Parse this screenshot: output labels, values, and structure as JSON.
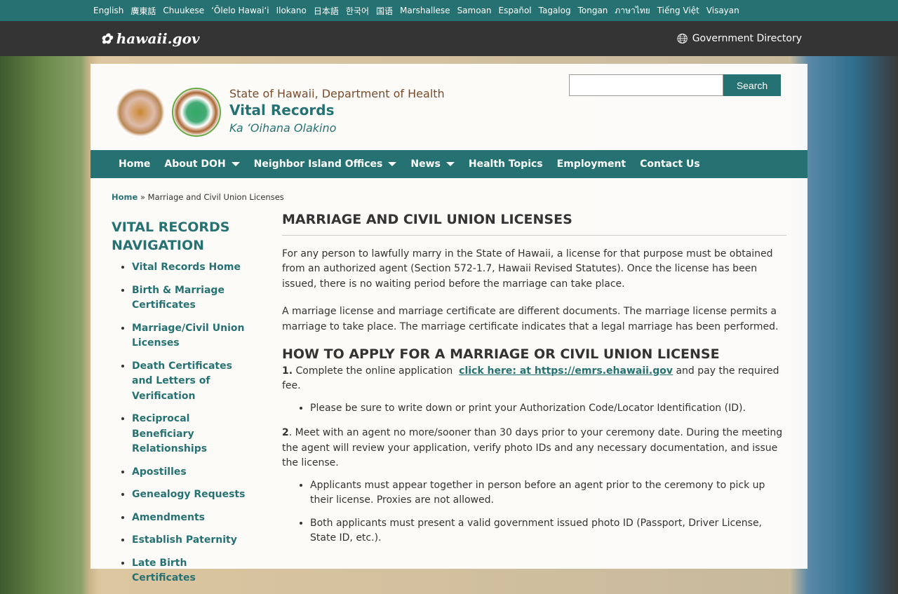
{
  "languages": [
    "English",
    "廣東話",
    "Chuukese",
    "ʻŌlelo Hawaiʻi",
    "Ilokano",
    "日本語",
    "한국어",
    "国语",
    "Marshallese",
    "Samoan",
    "Español",
    "Tagalog",
    "Tongan",
    "ภาษาไทย",
    "Tiếng Việt",
    "Visayan"
  ],
  "topbar": {
    "logo": "hawaii.gov",
    "directory": "Government Directory"
  },
  "header": {
    "line1": "State of Hawaii, Department of Health",
    "line2": "Vital Records",
    "line3": "Ka ʻOihana Olakino",
    "search_button": "Search",
    "search_value": ""
  },
  "nav": [
    {
      "label": "Home",
      "dropdown": false
    },
    {
      "label": "About DOH",
      "dropdown": true
    },
    {
      "label": "Neighbor Island Offices",
      "dropdown": true
    },
    {
      "label": "News",
      "dropdown": true
    },
    {
      "label": "Health Topics",
      "dropdown": false
    },
    {
      "label": "Employment",
      "dropdown": false
    },
    {
      "label": "Contact Us",
      "dropdown": false
    }
  ],
  "breadcrumb": {
    "home": "Home",
    "sep": " » ",
    "current": "Marriage and Civil Union Licenses"
  },
  "sidebar": {
    "title": "VITAL RECORDS NAVIGATION",
    "items": [
      "Vital Records Home",
      "Birth & Marriage Certificates",
      "Marriage/Civil Union Licenses",
      "Death Certificates and Letters of Verification",
      "Reciprocal Beneficiary Relationships",
      "Apostilles",
      "Genealogy Requests",
      "Amendments",
      "Establish Paternity",
      "Late Birth Certificates"
    ]
  },
  "main": {
    "title": "MARRIAGE AND CIVIL UNION LICENSES",
    "p1": "For any person to lawfully marry in the State of Hawaii, a license for that purpose must be obtained from an authorized agent (Section 572-1.7, Hawaii Revised Statutes). Once the license has been issued, there is no waiting period before the marriage can take place.",
    "p2": "A marriage license and marriage certificate are different documents. The marriage license permits a marriage to take place. The marriage certificate indicates that a legal marriage has been performed.",
    "h2": "HOW TO APPLY FOR A MARRIAGE OR CIVIL UNION LICENSE",
    "step1_num": "1.",
    "step1_text": " Complete the online application  ",
    "step1_link": "click here: at https://emrs.ehawaii.gov",
    "step1_after": " and pay the required fee.",
    "bullet1": "Please be sure to write down or print your Authorization Code/Locator Identification (ID).",
    "step2_num": "2",
    "step2_text": ". Meet with an agent no more/sooner than 30 days prior to your ceremony date. During the meeting the agent will review your application, verify photo IDs and any necessary documentation, and issue the license.",
    "bullet2": "Applicants must appear together in person before an agent prior to the ceremony to pick up their license. Proxies are not allowed.",
    "bullet3": "Both applicants must present a valid government issued photo ID (Passport, Driver License, State ID, etc.)."
  }
}
